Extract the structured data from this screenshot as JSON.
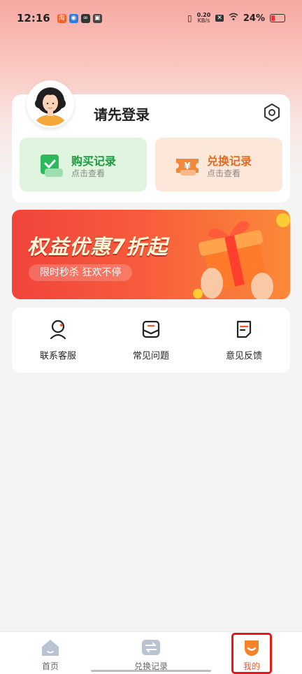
{
  "status_bar": {
    "time": "12:16",
    "net_speed_value": "0.20",
    "net_speed_unit": "KB/s",
    "battery": "24%"
  },
  "profile": {
    "login_prompt": "请先登录",
    "buy_records": {
      "title": "购买记录",
      "subtitle": "点击查看",
      "color": "#1b9a3e"
    },
    "exchange_records": {
      "title": "兑换记录",
      "subtitle": "点击查看",
      "color": "#e36b1f"
    }
  },
  "banner": {
    "headline": "权益优惠7折起",
    "tagline": "限时秒杀  狂欢不停"
  },
  "services": [
    {
      "label": "联系客服",
      "icon": "customer-service-icon"
    },
    {
      "label": "常见问题",
      "icon": "faq-icon"
    },
    {
      "label": "意见反馈",
      "icon": "feedback-icon"
    }
  ],
  "tabs": [
    {
      "label": "首页",
      "icon": "home-icon",
      "active": false
    },
    {
      "label": "兑换记录",
      "icon": "exchange-icon",
      "active": false
    },
    {
      "label": "我的",
      "icon": "profile-icon",
      "active": true
    }
  ],
  "colors": {
    "accent": "#f05a2a",
    "highlight": "#e01a1a"
  }
}
